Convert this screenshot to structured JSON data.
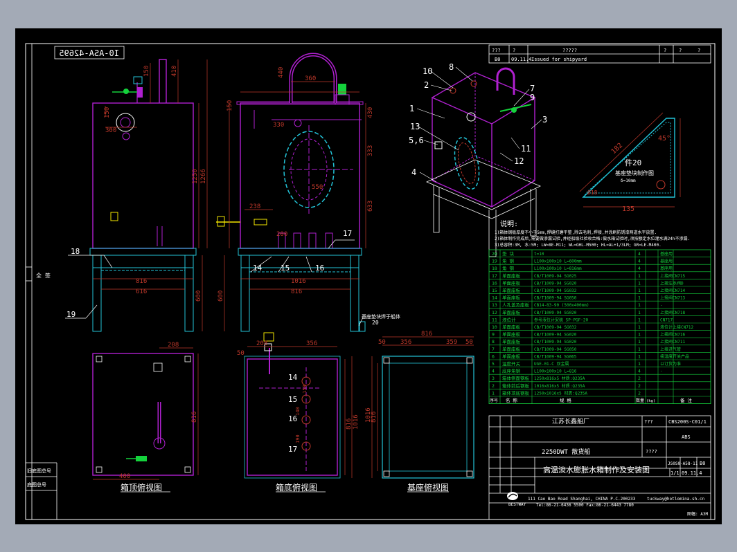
{
  "colors": {
    "background": "#a3aab6",
    "canvas": "#000000",
    "frame": "#ffffff",
    "tank": "#b020d0",
    "dim": "#c0392b",
    "cyan": "#23c4d8",
    "green": "#14d23c",
    "yellow": "#f2e600"
  },
  "drawing_no_mirrored": "I0-ASA-42695",
  "revision": {
    "row1": [
      "???",
      "?",
      "?????",
      "?",
      "?",
      "?"
    ],
    "row2": [
      "B0",
      "09.11.4",
      "Issued for shipyard"
    ]
  },
  "views": {
    "top": "箱顶俯视图",
    "bottom": "箱底俯视图",
    "base": "基座俯视图"
  },
  "part20": {
    "title": "件20",
    "caption": "基座垫块制作图",
    "note": "δ=10mm",
    "dims": [
      "182",
      "45°",
      "135",
      "Ø18"
    ]
  },
  "notes": {
    "title": "说明:",
    "lines": [
      "1)箱体钢板厚度不小于5mm,焊缝打磨平整,除去毛刺,焊接,并涂刷防锈漆两道水平放置.",
      "2)箱体制作完成后,需要做渗漏试验,并经船级社验收合格:做水箱试验时,须按额定水位灌水满24h不渗漏.",
      "3)总容积:3M, 水:5M;   LW=8E-M11;   WL=GHL-M500;   HL=AL+1/3LM;   GR=LE-M400."
    ]
  },
  "bom": [
    {
      "no": "20",
      "name": "垫 块",
      "spec": "t=10",
      "qty": "4",
      "remark": "基座用"
    },
    {
      "no": "19",
      "name": "角 钢",
      "spec": "L100x100x10 L=600mm",
      "qty": "4",
      "remark": "基座用"
    },
    {
      "no": "18",
      "name": "角 钢",
      "spec": "L100x100x10 L=816mm",
      "qty": "4",
      "remark": "基座用"
    },
    {
      "no": "17",
      "name": "单面座板",
      "spec": "CB/T1009-94 SG025",
      "qty": "1",
      "remark": "上接阀CN715"
    },
    {
      "no": "16",
      "name": "单面座板",
      "spec": "CB/T1009-94 SG020",
      "qty": "1",
      "remark": "上接注水阀D"
    },
    {
      "no": "15",
      "name": "单面座板",
      "spec": "CB/T1009-94 SG032",
      "qty": "1",
      "remark": "上接阀CN714"
    },
    {
      "no": "14",
      "name": "单面座板",
      "spec": "CB/T1009-94 SG050",
      "qty": "1",
      "remark": "上接阀CN713"
    },
    {
      "no": "13",
      "name": "人孔盖及座板",
      "spec": "CB14-83-90 (500x400mm)",
      "qty": "1",
      "remark": "-"
    },
    {
      "no": "12",
      "name": "单面座板",
      "spec": "CB/T1009-94 SG020",
      "qty": "1",
      "remark": "上接阀CN718"
    },
    {
      "no": "11",
      "name": "液位计",
      "spec": "参考液位计安装 SP-PGF-20",
      "qty": "1",
      "remark": "CN717"
    },
    {
      "no": "10",
      "name": "单面座板",
      "spec": "CB/T1009-94 SG032",
      "qty": "1",
      "remark": "液位计上接CN712"
    },
    {
      "no": "9",
      "name": "单面座板",
      "spec": "CB/T1009-94 SG020",
      "qty": "1",
      "remark": "上接阀CN716"
    },
    {
      "no": "8",
      "name": "单面座板",
      "spec": "CB/T1009-94 SG020",
      "qty": "1",
      "remark": "上接阀CN711"
    },
    {
      "no": "7",
      "name": "单面座板",
      "spec": "CB/T1009-94 SG050",
      "qty": "1",
      "remark": "上接进气管"
    },
    {
      "no": "6",
      "name": "单面座板",
      "spec": "CB/T1009-94 SG065",
      "qty": "1",
      "remark": "接温度开关产品"
    },
    {
      "no": "5",
      "name": "温度开关",
      "spec": "UGE-01-C 双金属",
      "qty": "1",
      "remark": "以订货为准"
    },
    {
      "no": "4",
      "name": "底座角钢",
      "spec": "L100x100x10 L=816",
      "qty": "4",
      "remark": "-"
    },
    {
      "no": "3",
      "name": "箱体侧面钢板",
      "spec": "1250x816x5   材质:Q235A",
      "qty": "2",
      "remark": ""
    },
    {
      "no": "2",
      "name": "箱体前后钢板",
      "spec": "1016x816x5   材质:Q235A",
      "qty": "2",
      "remark": ""
    },
    {
      "no": "1",
      "name": "箱体顶底钢板",
      "spec": "1250x1016x5  材质:Q235A",
      "qty": "2",
      "remark": ""
    }
  ],
  "bom_header": {
    "no": "序号",
    "name": "名 称",
    "spec": "规   格",
    "qty": "数量",
    "unit_wt": "(kg)",
    "remark": "备 注"
  },
  "title_block": {
    "company": "江苏长鑫船厂",
    "dwg_no": "CBS200S-C01/1",
    "class": "ABS",
    "ship": "2250DWT 散货船",
    "drawing_title": "高温淡水膨胀水箱制作及安装图",
    "dwg_code": "JS0S0-A58-11",
    "rev_mark": "B0",
    "sheet": "1/1",
    "date": "09.11.4",
    "scale": "???",
    "qqq": "????",
    "address": "111 Cao Bao Road Shanghai, CHINA   P.C.200233",
    "tel": "Tel:86-21-6436 5500   Fax:86-21-6443 7780",
    "email": "tuckway@hotlomina.sh.cn",
    "logo_text": "BESTWAY",
    "paper": "图幅: A3M"
  },
  "left_strip": {
    "cell1": "全 签",
    "cell2": "旧底图总号",
    "cell3": "底图总号"
  },
  "dims": {
    "front": [
      "150",
      "410",
      "150",
      "300",
      "1250",
      "1266",
      "816",
      "616",
      "600",
      "18",
      "19"
    ],
    "side": [
      "440",
      "360",
      "150",
      "330",
      "430",
      "333",
      "633",
      "238",
      "550",
      "200",
      "1016",
      "816",
      "600",
      "14",
      "15",
      "16",
      "17",
      "20"
    ],
    "topview": [
      "208",
      "400",
      "816"
    ],
    "bottomview": [
      "50",
      "208",
      "356",
      "150",
      "140",
      "190",
      "816",
      "1016"
    ],
    "baseview": [
      "816",
      "50",
      "356",
      "359",
      "50",
      "1016",
      "816"
    ]
  },
  "iso_labels": [
    "10",
    "8",
    "2",
    "7",
    "9",
    "1",
    "3",
    "11",
    "13",
    "5,6",
    "12",
    "4"
  ],
  "side_note": "基座垫块焊于船体",
  "bottom_labels": [
    "14",
    "15",
    "16",
    "17"
  ]
}
